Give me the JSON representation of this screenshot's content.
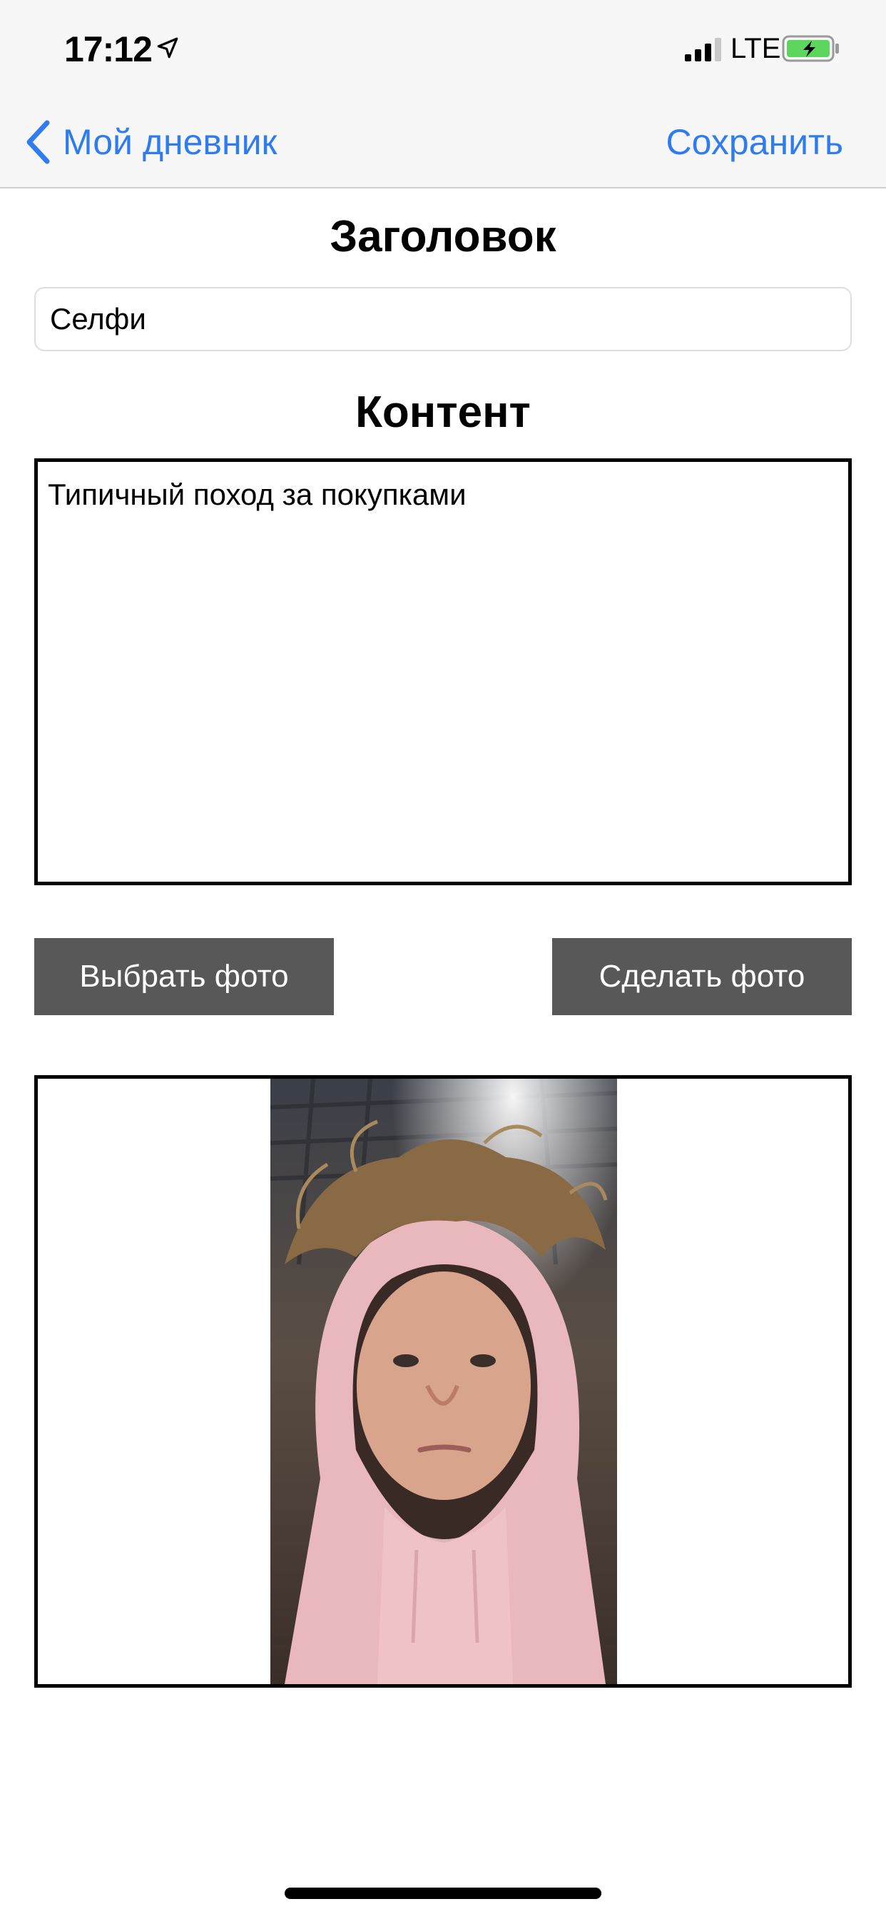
{
  "status_bar": {
    "time": "17:12",
    "network": "LTE",
    "icons": [
      "location-arrow-icon",
      "signal-bars-icon",
      "battery-charging-icon"
    ]
  },
  "nav": {
    "back_label": "Мой дневник",
    "save_label": "Сохранить"
  },
  "form": {
    "title_heading": "Заголовок",
    "title_value": "Селфи",
    "content_heading": "Контент",
    "content_value": "Типичный поход за покупками"
  },
  "buttons": {
    "pick_photo": "Выбрать фото",
    "take_photo": "Сделать фото"
  },
  "colors": {
    "accent": "#2f7cf0",
    "button_bg": "#585858",
    "battery_green": "#5cd65c"
  }
}
